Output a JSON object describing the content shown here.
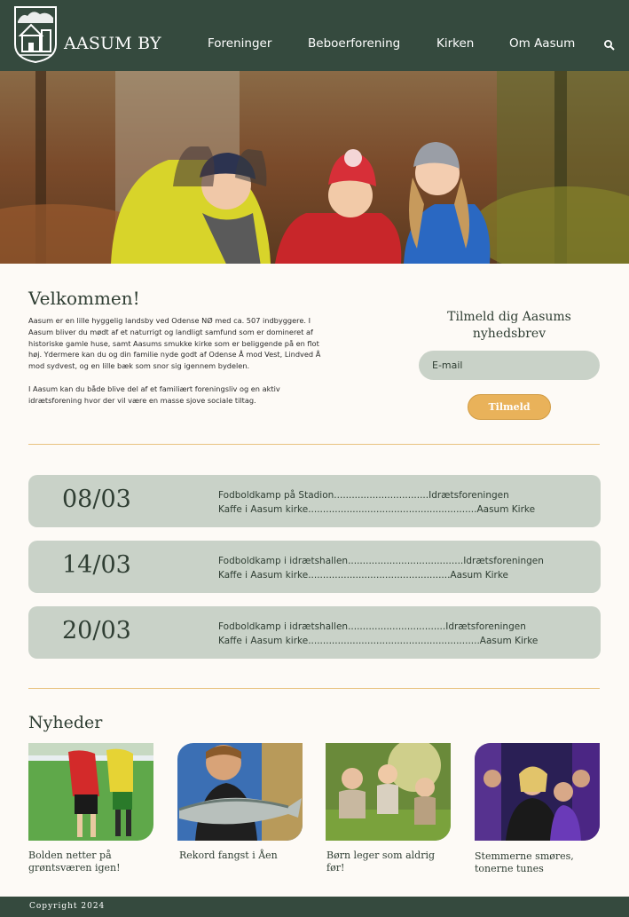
{
  "brand": {
    "name": "AASUM BY"
  },
  "nav": [
    "Foreninger",
    "Beboerforening",
    "Kirken",
    "Om Aasum"
  ],
  "welcome": {
    "title": "Velkommen!",
    "paragraphs": [
      "Aasum er en lille hyggelig landsby ved Odense NØ med ca. 507 indbyggere. I Aasum bliver du mødt af et naturrigt og landligt samfund som er domineret af historiske gamle huse, samt Aasums smukke kirke som er beliggende på en flot høj. Ydermere kan du og din familie nyde godt af Odense Å mod Vest, Lindved Å mod sydvest, og en lille bæk som snor sig igennem bydelen.",
      "I Aasum kan du både blive del af et familiært foreningsliv og en aktiv idrætsforening hvor der vil være en masse sjove sociale tiltag."
    ]
  },
  "newsletter": {
    "title": "Tilmeld dig Aasums nyhedsbrev",
    "placeholder": "E-mail",
    "button": "Tilmeld"
  },
  "events": [
    {
      "date": "08/03",
      "lines": [
        "Fodboldkamp på Stadion................................Idrætsforeningen",
        "Kaffe i Aasum kirke.........................................................Aasum Kirke"
      ]
    },
    {
      "date": "14/03",
      "lines": [
        "Fodboldkamp i idrætshallen.......................................Idrætsforeningen",
        "Kaffe i Aasum kirke................................................Aasum Kirke"
      ]
    },
    {
      "date": "20/03",
      "lines": [
        "Fodboldkamp i idrætshallen.................................Idrætsforeningen",
        "Kaffe i Aasum kirke..........................................................Aasum Kirke"
      ]
    }
  ],
  "news": {
    "title": "Nyheder",
    "items": [
      "Bolden netter på grøntsværen igen!",
      "Rekord fangst i Åen",
      "Børn leger som aldrig før!",
      "Stemmerne smøres, tonerne tunes"
    ]
  },
  "footer": {
    "copyright": "Copyright 2024"
  },
  "colors": {
    "header": "#354a3e",
    "accent": "#e9b25a",
    "card": "#c9d2c8",
    "background": "#fdfaf6"
  }
}
